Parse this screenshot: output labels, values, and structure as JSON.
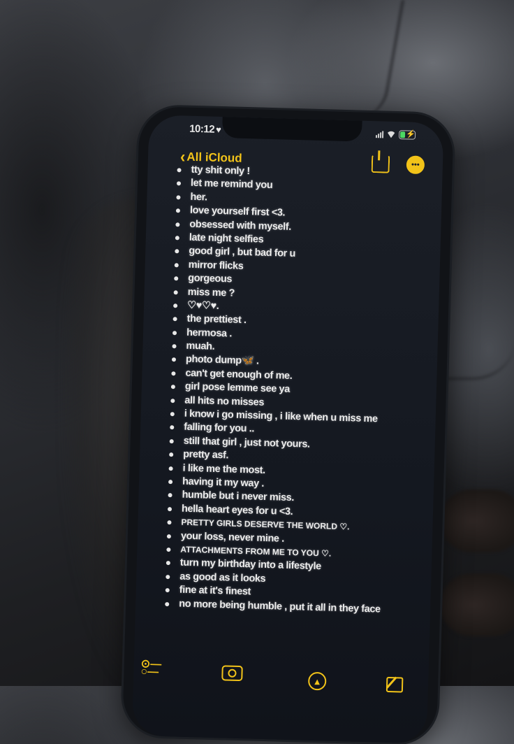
{
  "status_bar": {
    "time": "10:12",
    "focus_icon": "heart-icon",
    "icons": [
      "cellular-signal-icon",
      "wifi-icon",
      "battery-charging-icon"
    ]
  },
  "nav": {
    "back_label": "All iCloud",
    "back_icon": "chevron-left-icon",
    "share_icon": "share-icon",
    "more_icon": "more-options-icon"
  },
  "note": {
    "items": [
      "tty shit only !",
      "let me remind you",
      "her.",
      "love yourself first <3.",
      "obsessed with myself.",
      "late night selfies",
      "good girl , but bad for u",
      "mirror flicks",
      "gorgeous",
      "miss me ?",
      "♡♥♡♥.",
      "the prettiest .",
      "hermosa .",
      "muah.",
      "photo dump",
      "can't get enough of me.",
      "girl pose lemme see ya",
      "all hits no misses",
      "i know i go missing , i like when u miss me",
      "falling for you ..",
      "still that girl , just not yours.",
      "pretty asf.",
      "i like me the most.",
      "having it my way .",
      "humble but i never miss.",
      "hella heart eyes for u <3.",
      "PRETTY GIRLS DESERVE THE WORLD ♡.",
      "your loss, never mine .",
      "ATTACHMENTS FROM ME TO YOU ♡.",
      "turn my birthday into a lifestyle",
      "as good as it looks",
      "fine at it's finest",
      "no more being humble , put it all in they face"
    ],
    "photo_dump_emoji": "🦋",
    "photo_dump_suffix": " ."
  },
  "toolbar": {
    "checklist_icon": "checklist-icon",
    "camera_icon": "camera-icon",
    "markup_icon": "markup-pen-icon",
    "compose_icon": "compose-icon"
  },
  "colors": {
    "accent": "#f2c319",
    "text": "#ececec",
    "screen_bg": "#161a22"
  }
}
